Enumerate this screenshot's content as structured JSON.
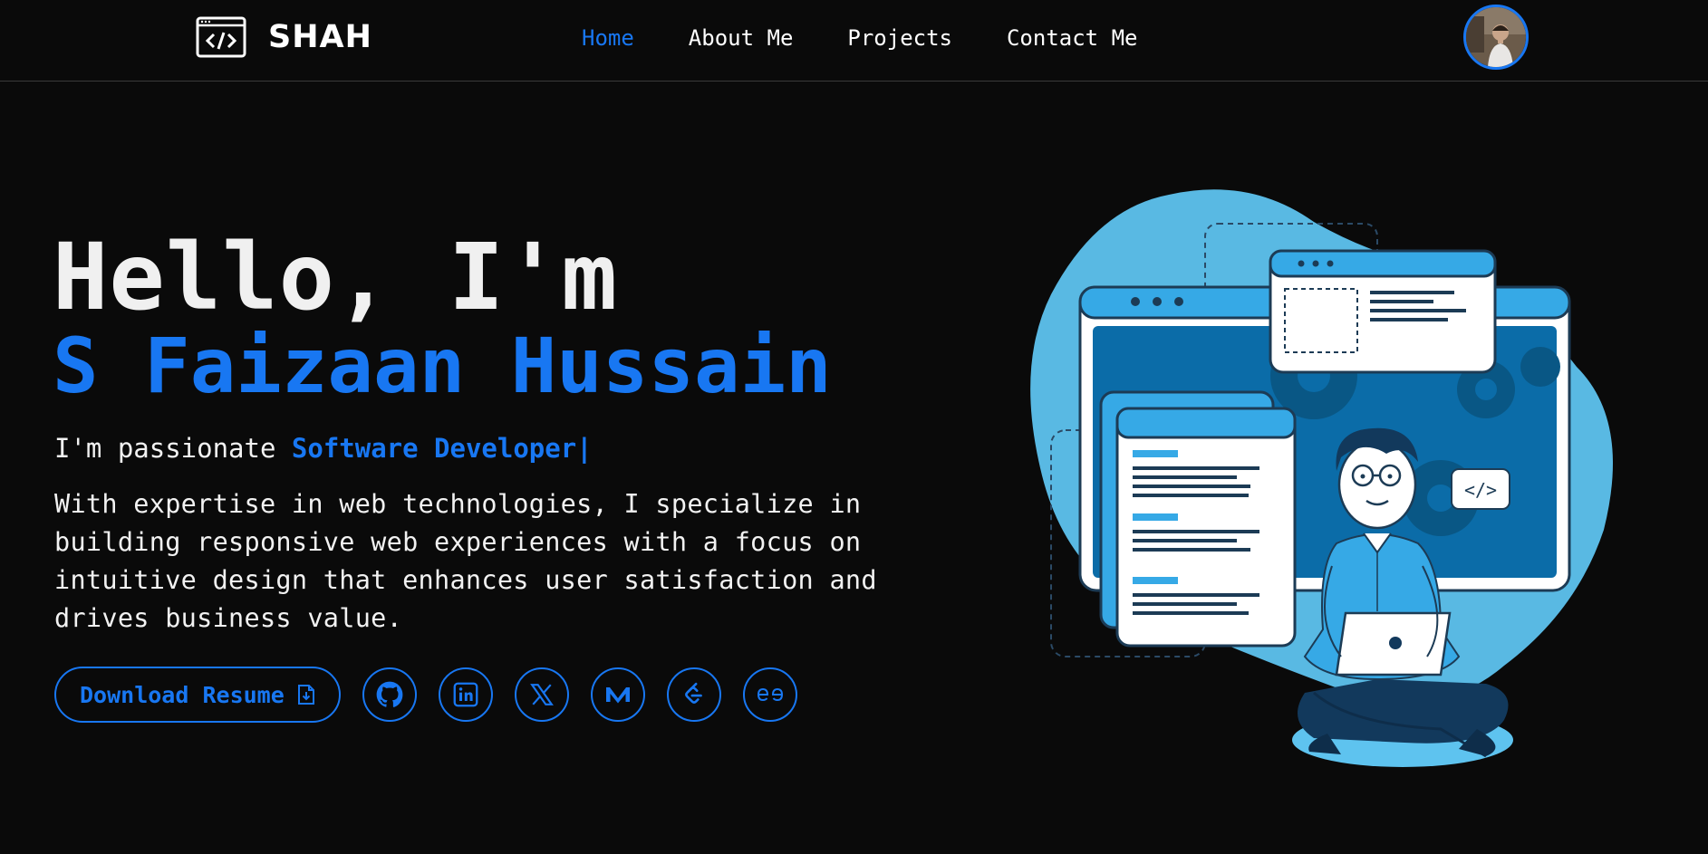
{
  "nav": {
    "logo_text": "SHAH",
    "logo_icon": "code-window-icon",
    "links": [
      {
        "label": "Home",
        "active": true
      },
      {
        "label": "About Me",
        "active": false
      },
      {
        "label": "Projects",
        "active": false
      },
      {
        "label": "Contact Me",
        "active": false
      }
    ],
    "avatar": "profile-avatar"
  },
  "hero": {
    "greeting": "Hello, I'm",
    "name": "S Faizaan Hussain",
    "passion_prefix": "I'm passionate ",
    "passion_role": "Software Developer|",
    "description": "With expertise in web technologies, I specialize in building responsive web experiences with a focus on intuitive design that enhances user satisfaction and drives business value.",
    "resume_button": "Download Resume",
    "resume_icon": "file-download-icon",
    "socials": [
      "github-icon",
      "linkedin-icon",
      "x-icon",
      "medium-icon",
      "leetcode-icon",
      "geeksforgeeks-icon"
    ]
  },
  "colors": {
    "accent": "#1877f2",
    "background": "#0a0a0a",
    "text": "#f2f2f2"
  }
}
